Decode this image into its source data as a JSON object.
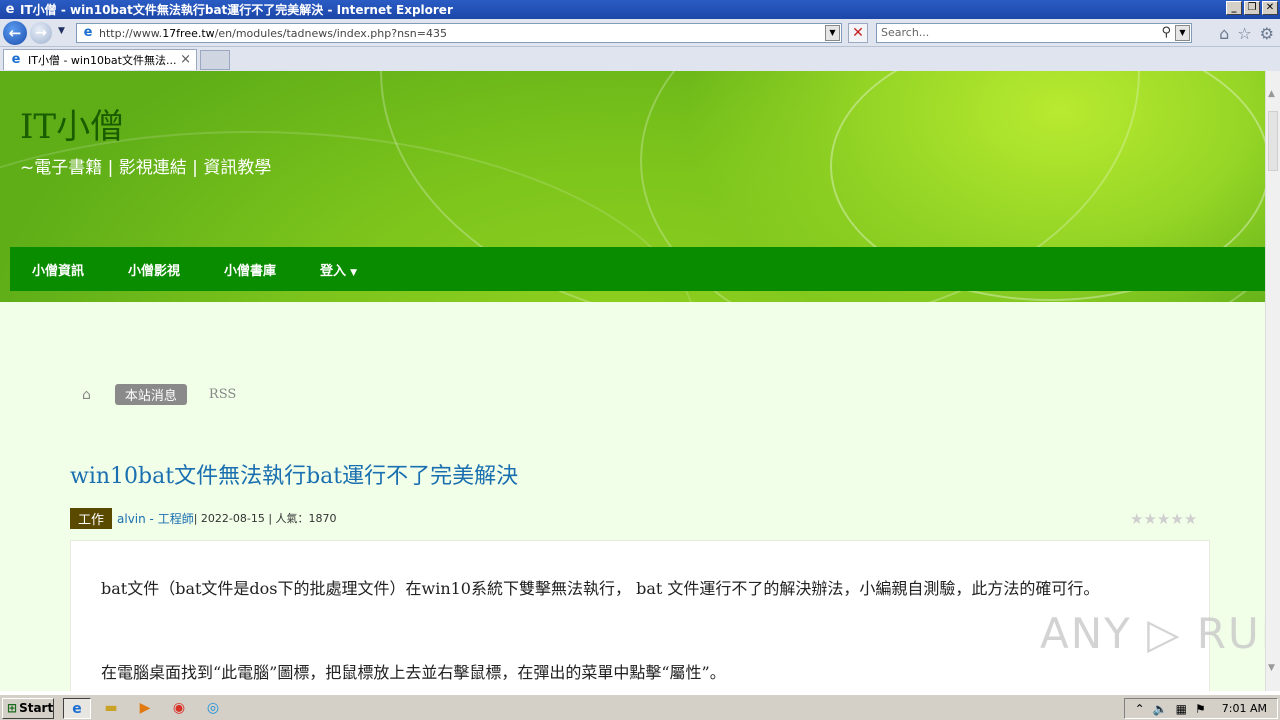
{
  "window": {
    "title": "IT小僧 - win10bat文件無法執行bat運行不了完美解決 - Internet Explorer",
    "minimize": "_",
    "restore": "❐",
    "close": "✕"
  },
  "address_bar": {
    "url_prefix": "http://www.",
    "url_domain": "17free.tw",
    "url_path": "/en/modules/tadnews/index.php?nsn=435"
  },
  "search": {
    "placeholder": "Search..."
  },
  "tab": {
    "label": "IT小僧 - win10bat文件無法...",
    "close": "×"
  },
  "site": {
    "title": "IT小僧",
    "subtitle": "~電子書籍 | 影視連結 | 資訊教學"
  },
  "nav": {
    "items": [
      "小僧資訊",
      "小僧影視",
      "小僧書庫",
      "登入"
    ]
  },
  "breadcrumb": {
    "badge": "本站消息",
    "rss": "RSS"
  },
  "article": {
    "title": "win10bat文件無法執行bat運行不了完美解決",
    "category": "工作",
    "author": "alvin - 工程師",
    "info": " | 2022-08-15 | 人氣：1870",
    "rating_stars": 5,
    "paragraphs": [
      "bat文件（bat文件是dos下的批處理文件）在win10系統下雙擊無法執行， bat 文件運行不了的解決辦法，小編親自測驗，此方法的確可行。",
      "在電腦桌面找到“此電腦”圖標，把鼠標放上去並右擊鼠標，在彈出的菜單中點擊“屬性”。"
    ]
  },
  "watermark": "ANY ▷ RUN",
  "taskbar": {
    "start_label": "Start",
    "clock": "7:01 AM"
  },
  "colors": {
    "nav_bg": "#0a8c00",
    "title_link": "#1a6fb0",
    "category_bg": "#5a4a00"
  }
}
